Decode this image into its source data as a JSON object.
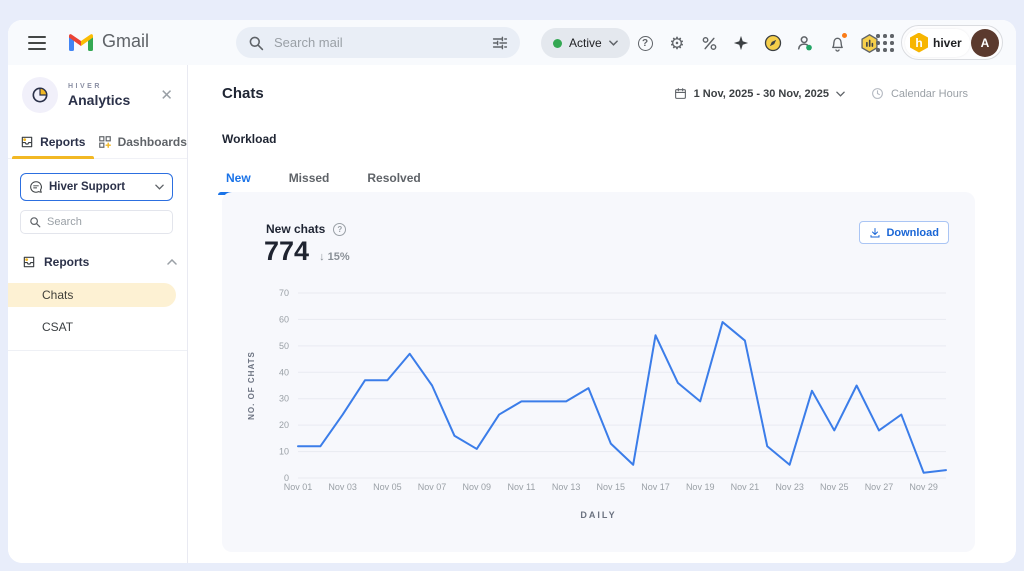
{
  "topbar": {
    "gmail_label": "Gmail",
    "search": {
      "placeholder": "Search mail"
    },
    "status_pill": {
      "label": "Active"
    },
    "account": {
      "product_label": "hiver",
      "avatar_initial": "A"
    }
  },
  "sidebar": {
    "brand": {
      "eyebrow": "HIVER",
      "title": "Analytics"
    },
    "tabs": [
      {
        "label": "Reports"
      },
      {
        "label": "Dashboards"
      }
    ],
    "inbox_selector": {
      "value": "Hiver Support"
    },
    "search": {
      "placeholder": "Search"
    },
    "nav": {
      "section_label": "Reports",
      "items": [
        {
          "label": "Chats"
        },
        {
          "label": "CSAT"
        }
      ]
    }
  },
  "main": {
    "title": "Chats",
    "toolbar": {
      "date_range": "1 Nov, 2025 - 30 Nov, 2025",
      "hours_mode": "Calendar Hours"
    },
    "section_title": "Workload",
    "tabs": [
      {
        "label": "New"
      },
      {
        "label": "Missed"
      },
      {
        "label": "Resolved"
      }
    ],
    "card": {
      "metric_label": "New chats",
      "metric_value": "774",
      "delta_arrow": "↓",
      "delta_value": "15%",
      "download_label": "Download"
    }
  },
  "chart_data": {
    "type": "line",
    "title": "New chats",
    "x": [
      "Nov 01",
      "Nov 02",
      "Nov 03",
      "Nov 04",
      "Nov 05",
      "Nov 06",
      "Nov 07",
      "Nov 08",
      "Nov 09",
      "Nov 10",
      "Nov 11",
      "Nov 12",
      "Nov 13",
      "Nov 14",
      "Nov 15",
      "Nov 16",
      "Nov 17",
      "Nov 18",
      "Nov 19",
      "Nov 20",
      "Nov 21",
      "Nov 22",
      "Nov 23",
      "Nov 24",
      "Nov 25",
      "Nov 26",
      "Nov 27",
      "Nov 28",
      "Nov 29",
      "Nov 30"
    ],
    "values": [
      12,
      12,
      24,
      37,
      37,
      47,
      35,
      16,
      11,
      24,
      29,
      29,
      29,
      34,
      13,
      5,
      54,
      36,
      29,
      59,
      52,
      12,
      5,
      33,
      18,
      35,
      18,
      24,
      2,
      3
    ],
    "shown_x_ticks": [
      "Nov 01",
      "Nov 03",
      "Nov 05",
      "Nov 07",
      "Nov 09",
      "Nov 11",
      "Nov 13",
      "Nov 15",
      "Nov 17",
      "Nov 19",
      "Nov 21",
      "Nov 23",
      "Nov 25",
      "Nov 27",
      "Nov 29"
    ],
    "xlabel": "DAILY",
    "ylabel": "NO. OF CHATS",
    "ylim": [
      0,
      70
    ],
    "yticks": [
      0,
      10,
      20,
      30,
      40,
      50,
      60,
      70
    ],
    "grid": true,
    "legend": "none",
    "line_color": "#3b7de9"
  },
  "colors": {
    "accent_blue": "#1a73e8",
    "hiver_yellow": "#f2b824",
    "active_item_bg": "#fdf1d3",
    "card_bg": "#f7f8fc",
    "topbar_bg": "#f8fafd",
    "frame_bg": "#e8edfa",
    "status_green": "#34a853",
    "notification_orange": "#fa7b17"
  }
}
